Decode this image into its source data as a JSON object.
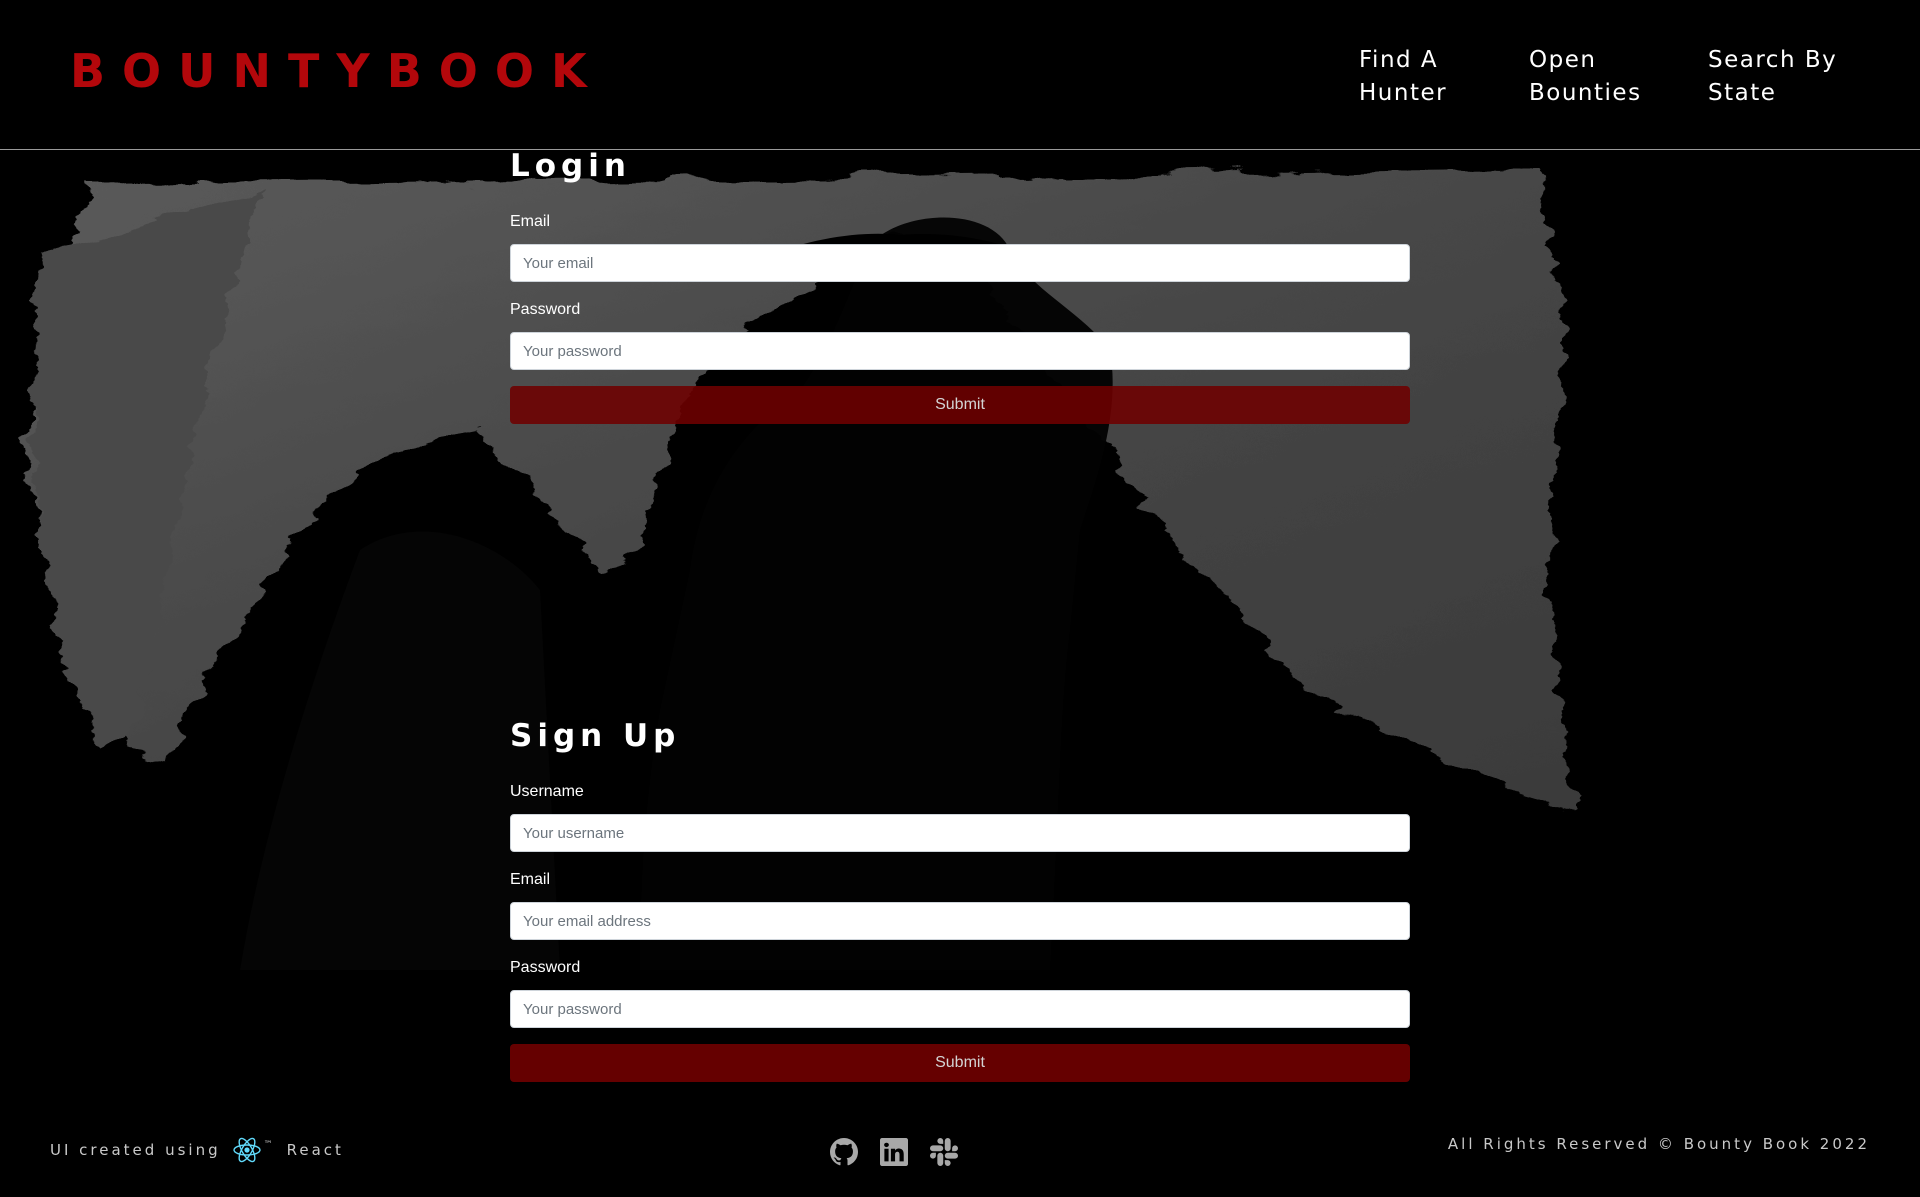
{
  "header": {
    "logo": "BOUNTYBOOK",
    "nav": [
      {
        "line1": "Find A",
        "line2": "Hunter"
      },
      {
        "line1": "Open",
        "line2": "Bounties"
      },
      {
        "line1": "Search By",
        "line2": "State"
      }
    ]
  },
  "login": {
    "title": "Login",
    "email_label": "Email",
    "email_placeholder": "Your email",
    "password_label": "Password",
    "password_placeholder": "Your password",
    "submit_label": "Submit"
  },
  "signup": {
    "title": "Sign Up",
    "username_label": "Username",
    "username_placeholder": "Your username",
    "email_label": "Email",
    "email_placeholder": "Your email address",
    "password_label": "Password",
    "password_placeholder": "Your password",
    "submit_label": "Submit"
  },
  "footer": {
    "left_text": "UI created using",
    "tm": "™",
    "react_label": "React",
    "right_text": "All Rights Reserved © Bounty Book 2022",
    "icons": [
      "github-icon",
      "linkedin-icon",
      "slack-icon"
    ]
  },
  "colors": {
    "brand": "#b3070b",
    "submit": "#650000",
    "react": "#61dafb"
  }
}
